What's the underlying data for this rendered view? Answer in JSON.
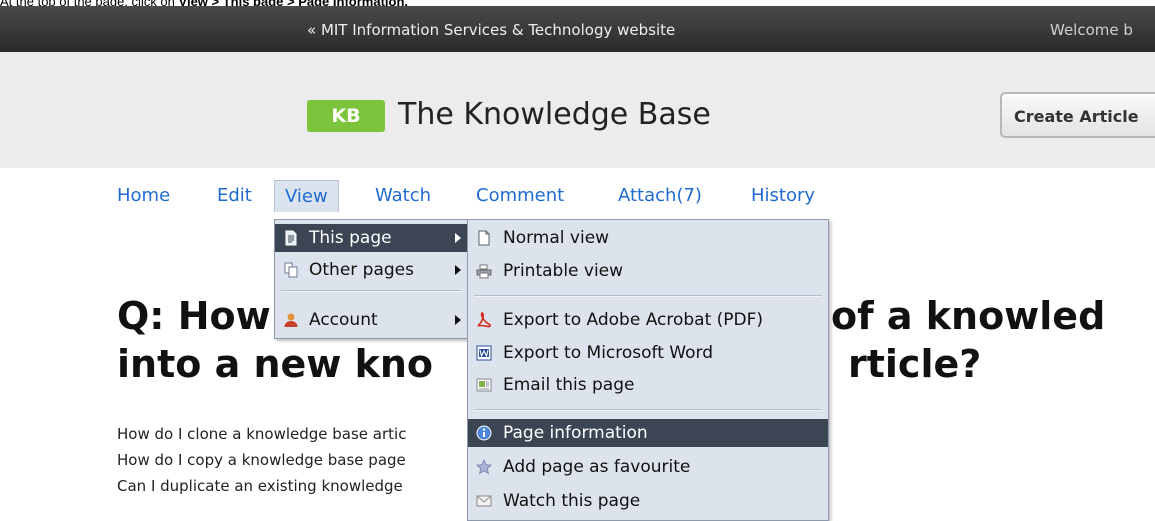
{
  "instruction": {
    "prefix": "At the top of the page, click on ",
    "path": "View > This page > Page Information."
  },
  "topbar": {
    "mit_link": "« MIT Information Services & Technology website",
    "welcome": "Welcome b"
  },
  "header": {
    "badge": "KB",
    "title": "The Knowledge Base",
    "create_button": "Create Article"
  },
  "nav": {
    "items": [
      {
        "label": "Home"
      },
      {
        "label": "Edit"
      },
      {
        "label": "View"
      },
      {
        "label": "Watch"
      },
      {
        "label": "Comment"
      },
      {
        "label": "Attach(7)"
      },
      {
        "label": "History"
      }
    ]
  },
  "view_menu": {
    "items": [
      {
        "label": "This page",
        "icon": "page-icon"
      },
      {
        "label": "Other pages",
        "icon": "pages-icon"
      },
      {
        "label": "Account",
        "icon": "user-icon"
      }
    ]
  },
  "page_menu": {
    "items": [
      {
        "label": "Normal view",
        "icon": "document-icon"
      },
      {
        "label": "Printable view",
        "icon": "printer-icon"
      },
      {
        "label": "Export to Adobe Acrobat (PDF)",
        "icon": "pdf-icon"
      },
      {
        "label": "Export to Microsoft Word",
        "icon": "word-icon"
      },
      {
        "label": "Email this page",
        "icon": "email-icon"
      },
      {
        "label": "Page information",
        "icon": "info-icon"
      },
      {
        "label": "Add page as favourite",
        "icon": "star-icon"
      },
      {
        "label": "Watch this page",
        "icon": "envelope-icon"
      }
    ]
  },
  "article": {
    "title_line1_left": "Q: How",
    "title_line1_right": "of a knowled",
    "title_line2_left": "into a new kno",
    "title_line2_right": "rticle?",
    "lines": [
      "How do I clone a knowledge base artic",
      "How do I copy a knowledge base page",
      "Can I duplicate an existing knowledge"
    ]
  },
  "colors": {
    "link": "#1f6bd1",
    "kb_green": "#7cc43c",
    "menu_bg": "#dde3ec",
    "menu_selected": "#3c4553"
  }
}
